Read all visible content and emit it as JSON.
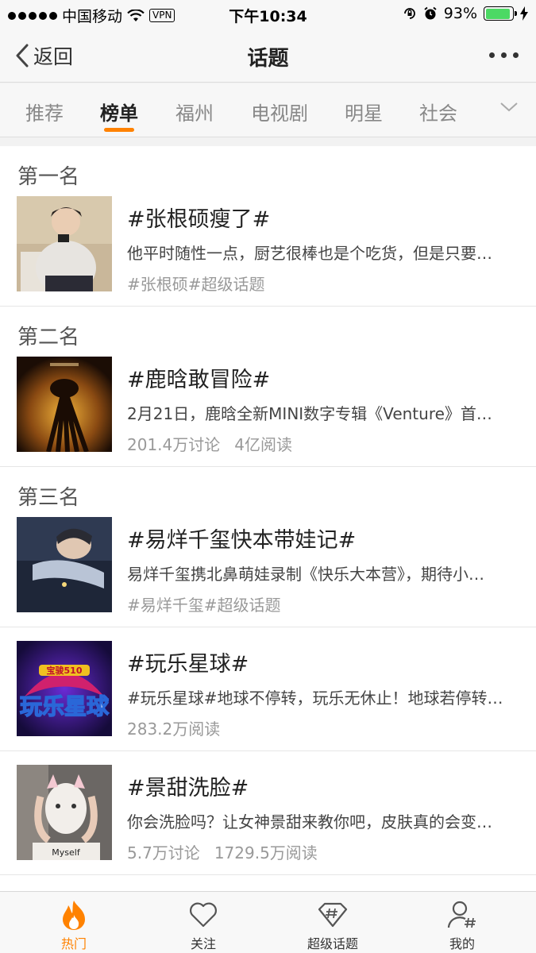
{
  "status_bar": {
    "carrier": "中国移动",
    "vpn": "VPN",
    "time": "下午10:34",
    "battery": "93%",
    "battery_level": 0.93
  },
  "nav": {
    "back_label": "返回",
    "title": "话题"
  },
  "tabs": [
    "推荐",
    "榜单",
    "福州",
    "电视剧",
    "明星",
    "社会"
  ],
  "active_tab": "榜单",
  "items": [
    {
      "rank": "第一名",
      "title": "#张根硕瘦了#",
      "desc": "他平时随性一点，厨艺很棒也是个吃货，但是只要…",
      "meta": [
        "#张根硕#超级话题"
      ]
    },
    {
      "rank": "第二名",
      "title": "#鹿晗敢冒险#",
      "desc": "2月21日，鹿晗全新MINI数字专辑《Venture》首…",
      "meta": [
        "201.4万讨论",
        "4亿阅读"
      ]
    },
    {
      "rank": "第三名",
      "title": "#易烊千玺快本带娃记#",
      "desc": "易烊千玺携北鼻萌娃录制《快乐大本营》，期待小…",
      "meta": [
        "#易烊千玺#超级话题"
      ]
    },
    {
      "rank": "",
      "title": "#玩乐星球#",
      "desc": "#玩乐星球#地球不停转，玩乐无休止！地球若停转…",
      "meta": [
        "283.2万阅读"
      ],
      "thumb_text_top": "宝骏510",
      "thumb_text_main": "玩乐星球"
    },
    {
      "rank": "",
      "title": "#景甜洗脸#",
      "desc": "你会洗脸吗？让女神景甜来教你吧，皮肤真的会变…",
      "meta": [
        "5.7万讨论",
        "1729.5万阅读"
      ],
      "thumb_text": "Myself"
    }
  ],
  "bottom_tabs": [
    {
      "label": "热门",
      "icon": "flame-icon",
      "active": true
    },
    {
      "label": "关注",
      "icon": "heart-icon",
      "active": false
    },
    {
      "label": "超级话题",
      "icon": "hashtag-diamond-icon",
      "active": false
    },
    {
      "label": "我的",
      "icon": "user-hashtag-icon",
      "active": false
    }
  ],
  "colors": {
    "accent": "#ff8200",
    "battery": "#4cd964"
  }
}
